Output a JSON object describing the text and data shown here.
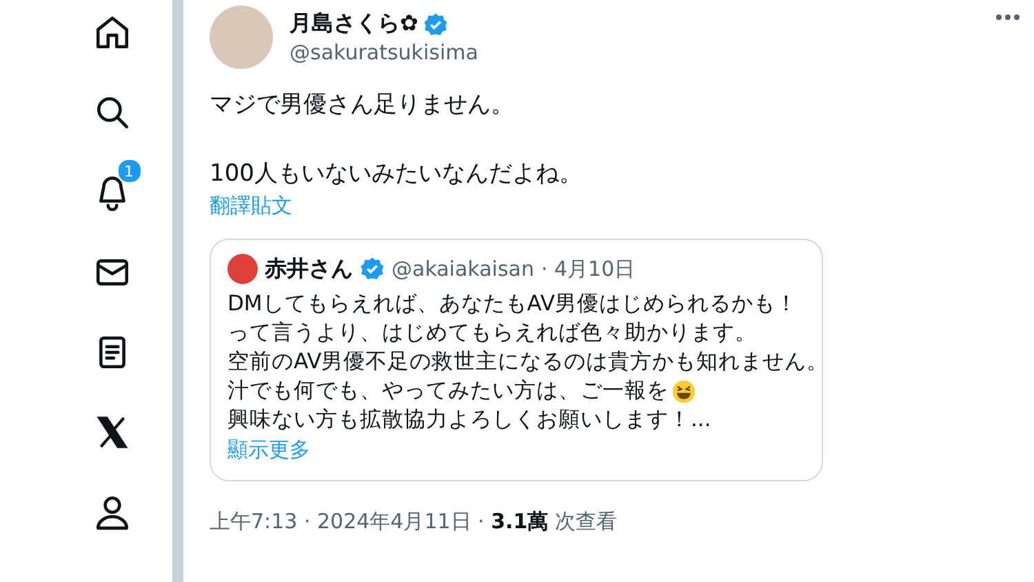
{
  "sidebar": {
    "notification_badge": "1"
  },
  "tweet": {
    "author": {
      "name": "月島さくら✿",
      "handle": "@sakuratsukisima",
      "verified": true
    },
    "paragraphs": [
      "マジで男優さん足りません。",
      "100人もいないみたいなんだよね。"
    ],
    "translate_link": "翻譯貼文",
    "quote": {
      "author": {
        "name": "赤井さん",
        "handle": "@akaiakaisan",
        "verified": true
      },
      "date": "· 4月10日",
      "lines": [
        {
          "text": "DMしてもらえれば、あなたもAV男優はじめられるかも！",
          "emoji": false
        },
        {
          "text": "って言うより、はじめてもらえれば色々助かります。",
          "emoji": false
        },
        {
          "text": "空前のAV男優不足の救世主になるのは貴方かも知れません。",
          "emoji": false
        },
        {
          "text": "汁でも何でも、やってみたい方は、ご一報を",
          "emoji": true
        },
        {
          "text": "興味ない方も拡散協力よろしくお願いします！...",
          "emoji": false
        }
      ],
      "show_more": "顯示更多"
    },
    "meta": "上午7:13 · 2024年4月11日 · **3.1萬** 次查看"
  }
}
